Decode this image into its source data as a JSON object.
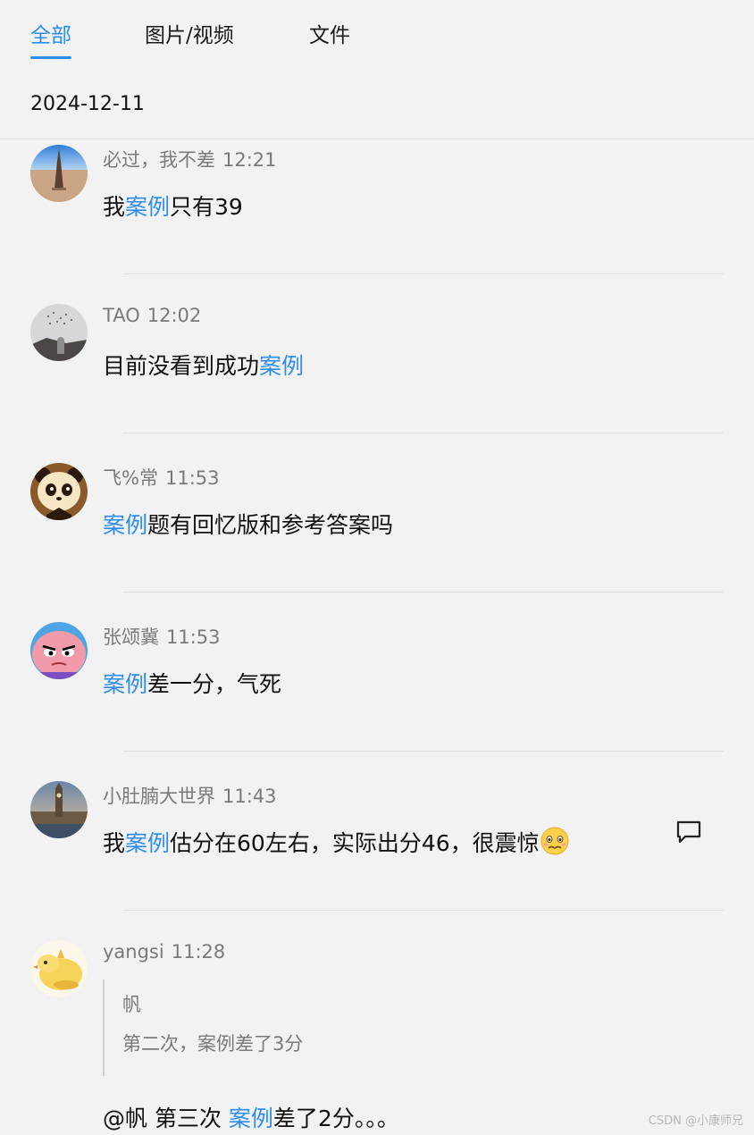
{
  "tabs": [
    {
      "label": "全部",
      "active": true
    },
    {
      "label": "图片/视频",
      "active": false
    },
    {
      "label": "文件",
      "active": false
    }
  ],
  "date": "2024-12-11",
  "accent_color": "#2d8cf0",
  "messages": [
    {
      "author": "必过，我不差",
      "time": "12:21",
      "avatar": "desert-tower-avatar",
      "text_parts": [
        "我",
        "案例",
        "只有39"
      ]
    },
    {
      "author": "TAO",
      "time": "12:02",
      "avatar": "rock-birds-avatar",
      "text_parts": [
        "目前没看到成功",
        "案例"
      ]
    },
    {
      "author": "飞%常",
      "time": "11:53",
      "avatar": "panda-avatar",
      "text_parts": [
        "案例",
        "题有回忆版和参考答案吗"
      ]
    },
    {
      "author": "张颂冀",
      "time": "11:53",
      "avatar": "patrick-star-avatar",
      "text_parts": [
        "案例",
        "差一分，气死"
      ]
    },
    {
      "author": "小肚腩大世界",
      "time": "11:43",
      "avatar": "big-ben-avatar",
      "text_parts": [
        "我",
        "案例",
        "估分在60左右，实际出分46，很震惊"
      ],
      "emoji": "worried-face-emoji",
      "reply_icon": "comment-icon"
    },
    {
      "author": "yangsi",
      "time": "11:28",
      "avatar": "cartoon-chick-avatar",
      "quote": {
        "author": "帆",
        "text": "第二次，案例差了3分"
      },
      "text_parts": [
        "@帆 第三次 ",
        "案例",
        "差了2分。。。"
      ]
    }
  ],
  "watermark": "CSDN @小康师兄"
}
